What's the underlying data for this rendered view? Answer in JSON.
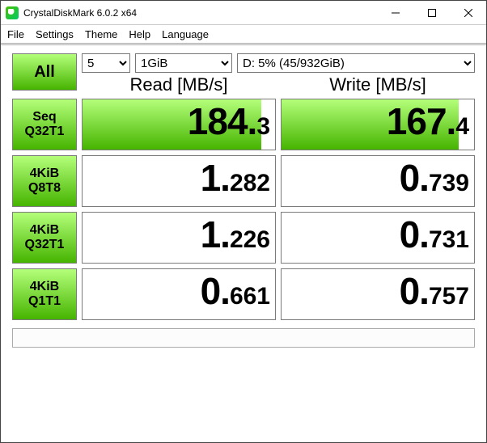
{
  "window": {
    "title": "CrystalDiskMark 6.0.2 x64"
  },
  "menu": {
    "file": "File",
    "settings": "Settings",
    "theme": "Theme",
    "help": "Help",
    "language": "Language"
  },
  "controls": {
    "count": "5",
    "size": "1GiB",
    "drive": "D: 5% (45/932GiB)"
  },
  "headers": {
    "read": "Read [MB/s]",
    "write": "Write [MB/s]"
  },
  "buttons": {
    "all": "All",
    "r0": "Seq\nQ32T1",
    "r1": "4KiB\nQ8T8",
    "r2": "4KiB\nQ32T1",
    "r3": "4KiB\nQ1T1"
  },
  "results": {
    "r0": {
      "read_int": "184.",
      "read_dec": "3",
      "write_int": "167.",
      "write_dec": "4",
      "read_fill": "93%",
      "write_fill": "92%"
    },
    "r1": {
      "read_int": "1.",
      "read_dec": "282",
      "write_int": "0.",
      "write_dec": "739",
      "read_fill": "0%",
      "write_fill": "0%"
    },
    "r2": {
      "read_int": "1.",
      "read_dec": "226",
      "write_int": "0.",
      "write_dec": "731",
      "read_fill": "0%",
      "write_fill": "0%"
    },
    "r3": {
      "read_int": "0.",
      "read_dec": "661",
      "write_int": "0.",
      "write_dec": "757",
      "read_fill": "0%",
      "write_fill": "0%"
    }
  },
  "status": ""
}
